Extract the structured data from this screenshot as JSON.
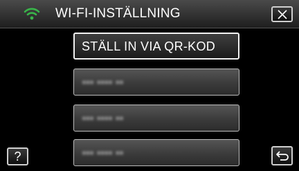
{
  "header": {
    "title": "WI-FI-INSTÄLLNING",
    "status_icon": "wifi-icon",
    "close_icon": "close-icon"
  },
  "menu": {
    "items": [
      {
        "label": "STÄLL IN VIA QR-KOD",
        "selected": true
      },
      {
        "label": "▪▪▪ ▪▪▪▪ ▪▪",
        "selected": false
      },
      {
        "label": "▪▪▪ ▪▪▪▪ ▪▪",
        "selected": false
      },
      {
        "label": "▪▪▪ ▪▪▪▪ ▪▪",
        "selected": false
      }
    ]
  },
  "footer": {
    "help_label": "?",
    "back_icon": "return-icon"
  },
  "colors": {
    "wifi_green": "#39b54a",
    "background": "#000000",
    "text": "#ffffff"
  }
}
